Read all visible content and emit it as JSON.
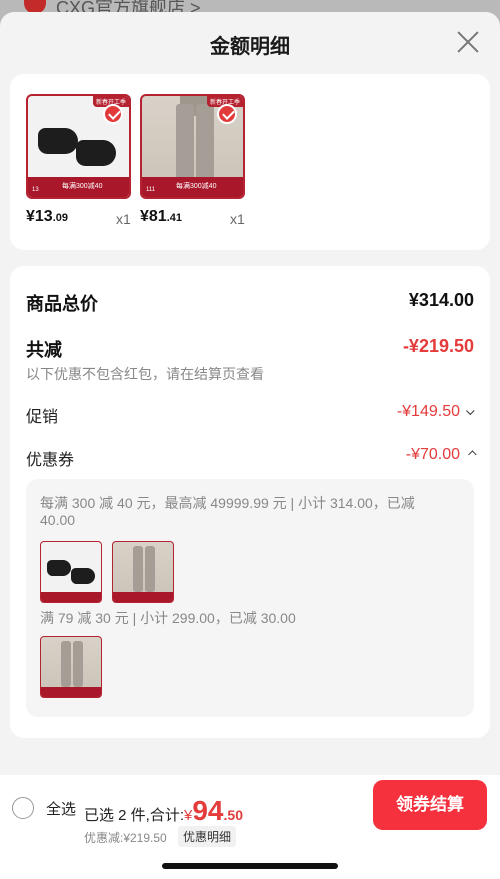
{
  "background": {
    "store_name": "CXG官方旗舰店 >"
  },
  "sheet": {
    "title": "金额明细"
  },
  "products": [
    {
      "name": "black-socks",
      "price_int": "¥13",
      "price_dec": ".09",
      "qty": "x1",
      "badge": "新春开工季",
      "deal": "每满300减40",
      "code": "13"
    },
    {
      "name": "grey-trousers",
      "price_int": "¥81",
      "price_dec": ".41",
      "qty": "x1",
      "badge": "新春开工季",
      "deal": "每满300减40",
      "code": "111"
    }
  ],
  "summary": {
    "total_label": "商品总价",
    "total_value": "¥314.00",
    "discount_label": "共减",
    "discount_value": "-¥219.50",
    "note": "以下优惠不包含红包，请在结算页查看",
    "promo_label": "促销",
    "promo_value": "-¥149.50",
    "coupon_label": "优惠券",
    "coupon_value": "-¥70.00"
  },
  "coupons": {
    "rule1_line1": "每满 300 减 40 元，最高减 49999.99 元 | 小计 314.00，已减",
    "rule1_line2": "40.00",
    "rule2": "满 79 减 30 元 | 小计 299.00，已减 30.00"
  },
  "footer": {
    "select_all": "全选",
    "selected_text": "已选 2 件,合计:",
    "yen": "¥",
    "total_int": "94",
    "total_dec": ".50",
    "saved_text": "优惠减:¥219.50",
    "detail_link": "优惠明细",
    "checkout": "领券结算"
  },
  "colors": {
    "accent": "#f5313d",
    "discount": "#e43b3b",
    "product_frame": "#b52230"
  }
}
